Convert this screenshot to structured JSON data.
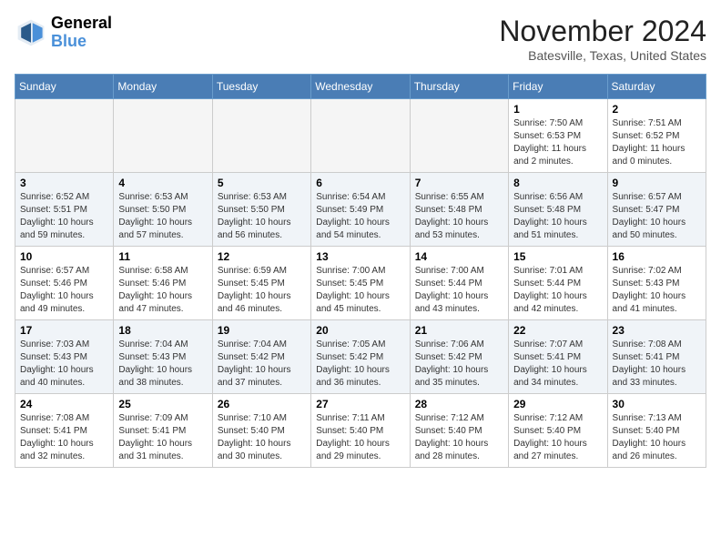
{
  "header": {
    "logo_general": "General",
    "logo_blue": "Blue",
    "month_title": "November 2024",
    "location": "Batesville, Texas, United States"
  },
  "weekdays": [
    "Sunday",
    "Monday",
    "Tuesday",
    "Wednesday",
    "Thursday",
    "Friday",
    "Saturday"
  ],
  "weeks": [
    [
      {
        "day": "",
        "info": ""
      },
      {
        "day": "",
        "info": ""
      },
      {
        "day": "",
        "info": ""
      },
      {
        "day": "",
        "info": ""
      },
      {
        "day": "",
        "info": ""
      },
      {
        "day": "1",
        "info": "Sunrise: 7:50 AM\nSunset: 6:53 PM\nDaylight: 11 hours\nand 2 minutes."
      },
      {
        "day": "2",
        "info": "Sunrise: 7:51 AM\nSunset: 6:52 PM\nDaylight: 11 hours\nand 0 minutes."
      }
    ],
    [
      {
        "day": "3",
        "info": "Sunrise: 6:52 AM\nSunset: 5:51 PM\nDaylight: 10 hours\nand 59 minutes."
      },
      {
        "day": "4",
        "info": "Sunrise: 6:53 AM\nSunset: 5:50 PM\nDaylight: 10 hours\nand 57 minutes."
      },
      {
        "day": "5",
        "info": "Sunrise: 6:53 AM\nSunset: 5:50 PM\nDaylight: 10 hours\nand 56 minutes."
      },
      {
        "day": "6",
        "info": "Sunrise: 6:54 AM\nSunset: 5:49 PM\nDaylight: 10 hours\nand 54 minutes."
      },
      {
        "day": "7",
        "info": "Sunrise: 6:55 AM\nSunset: 5:48 PM\nDaylight: 10 hours\nand 53 minutes."
      },
      {
        "day": "8",
        "info": "Sunrise: 6:56 AM\nSunset: 5:48 PM\nDaylight: 10 hours\nand 51 minutes."
      },
      {
        "day": "9",
        "info": "Sunrise: 6:57 AM\nSunset: 5:47 PM\nDaylight: 10 hours\nand 50 minutes."
      }
    ],
    [
      {
        "day": "10",
        "info": "Sunrise: 6:57 AM\nSunset: 5:46 PM\nDaylight: 10 hours\nand 49 minutes."
      },
      {
        "day": "11",
        "info": "Sunrise: 6:58 AM\nSunset: 5:46 PM\nDaylight: 10 hours\nand 47 minutes."
      },
      {
        "day": "12",
        "info": "Sunrise: 6:59 AM\nSunset: 5:45 PM\nDaylight: 10 hours\nand 46 minutes."
      },
      {
        "day": "13",
        "info": "Sunrise: 7:00 AM\nSunset: 5:45 PM\nDaylight: 10 hours\nand 45 minutes."
      },
      {
        "day": "14",
        "info": "Sunrise: 7:00 AM\nSunset: 5:44 PM\nDaylight: 10 hours\nand 43 minutes."
      },
      {
        "day": "15",
        "info": "Sunrise: 7:01 AM\nSunset: 5:44 PM\nDaylight: 10 hours\nand 42 minutes."
      },
      {
        "day": "16",
        "info": "Sunrise: 7:02 AM\nSunset: 5:43 PM\nDaylight: 10 hours\nand 41 minutes."
      }
    ],
    [
      {
        "day": "17",
        "info": "Sunrise: 7:03 AM\nSunset: 5:43 PM\nDaylight: 10 hours\nand 40 minutes."
      },
      {
        "day": "18",
        "info": "Sunrise: 7:04 AM\nSunset: 5:43 PM\nDaylight: 10 hours\nand 38 minutes."
      },
      {
        "day": "19",
        "info": "Sunrise: 7:04 AM\nSunset: 5:42 PM\nDaylight: 10 hours\nand 37 minutes."
      },
      {
        "day": "20",
        "info": "Sunrise: 7:05 AM\nSunset: 5:42 PM\nDaylight: 10 hours\nand 36 minutes."
      },
      {
        "day": "21",
        "info": "Sunrise: 7:06 AM\nSunset: 5:42 PM\nDaylight: 10 hours\nand 35 minutes."
      },
      {
        "day": "22",
        "info": "Sunrise: 7:07 AM\nSunset: 5:41 PM\nDaylight: 10 hours\nand 34 minutes."
      },
      {
        "day": "23",
        "info": "Sunrise: 7:08 AM\nSunset: 5:41 PM\nDaylight: 10 hours\nand 33 minutes."
      }
    ],
    [
      {
        "day": "24",
        "info": "Sunrise: 7:08 AM\nSunset: 5:41 PM\nDaylight: 10 hours\nand 32 minutes."
      },
      {
        "day": "25",
        "info": "Sunrise: 7:09 AM\nSunset: 5:41 PM\nDaylight: 10 hours\nand 31 minutes."
      },
      {
        "day": "26",
        "info": "Sunrise: 7:10 AM\nSunset: 5:40 PM\nDaylight: 10 hours\nand 30 minutes."
      },
      {
        "day": "27",
        "info": "Sunrise: 7:11 AM\nSunset: 5:40 PM\nDaylight: 10 hours\nand 29 minutes."
      },
      {
        "day": "28",
        "info": "Sunrise: 7:12 AM\nSunset: 5:40 PM\nDaylight: 10 hours\nand 28 minutes."
      },
      {
        "day": "29",
        "info": "Sunrise: 7:12 AM\nSunset: 5:40 PM\nDaylight: 10 hours\nand 27 minutes."
      },
      {
        "day": "30",
        "info": "Sunrise: 7:13 AM\nSunset: 5:40 PM\nDaylight: 10 hours\nand 26 minutes."
      }
    ]
  ]
}
